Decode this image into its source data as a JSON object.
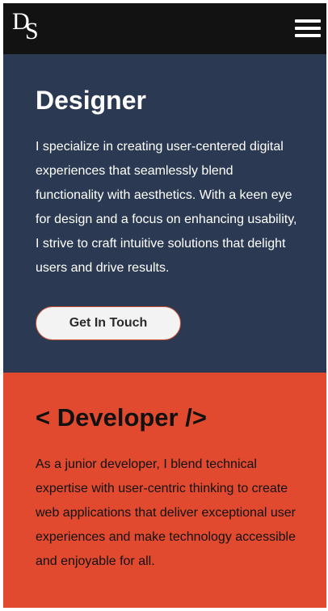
{
  "header": {
    "logo_d": "D",
    "logo_s": "S",
    "menu_icon": "hamburger-menu-icon"
  },
  "designer": {
    "title": "Designer",
    "text": "I specialize in creating user-centered digital experiences that seamlessly blend functionality with aesthetics. With a keen eye for design and a focus on enhancing usability, I strive to craft intuitive solutions that delight users and drive results.",
    "button_label": "Get In Touch"
  },
  "developer": {
    "title": "< Developer />",
    "text": "As a junior developer, I blend technical expertise with user-centric thinking to create web applications that deliver exceptional user experiences and make technology accessible and enjoyable for all."
  },
  "colors": {
    "header_bg": "#121212",
    "designer_bg": "#2b3a52",
    "developer_bg": "#e14a2e",
    "button_border": "#c8513a"
  }
}
